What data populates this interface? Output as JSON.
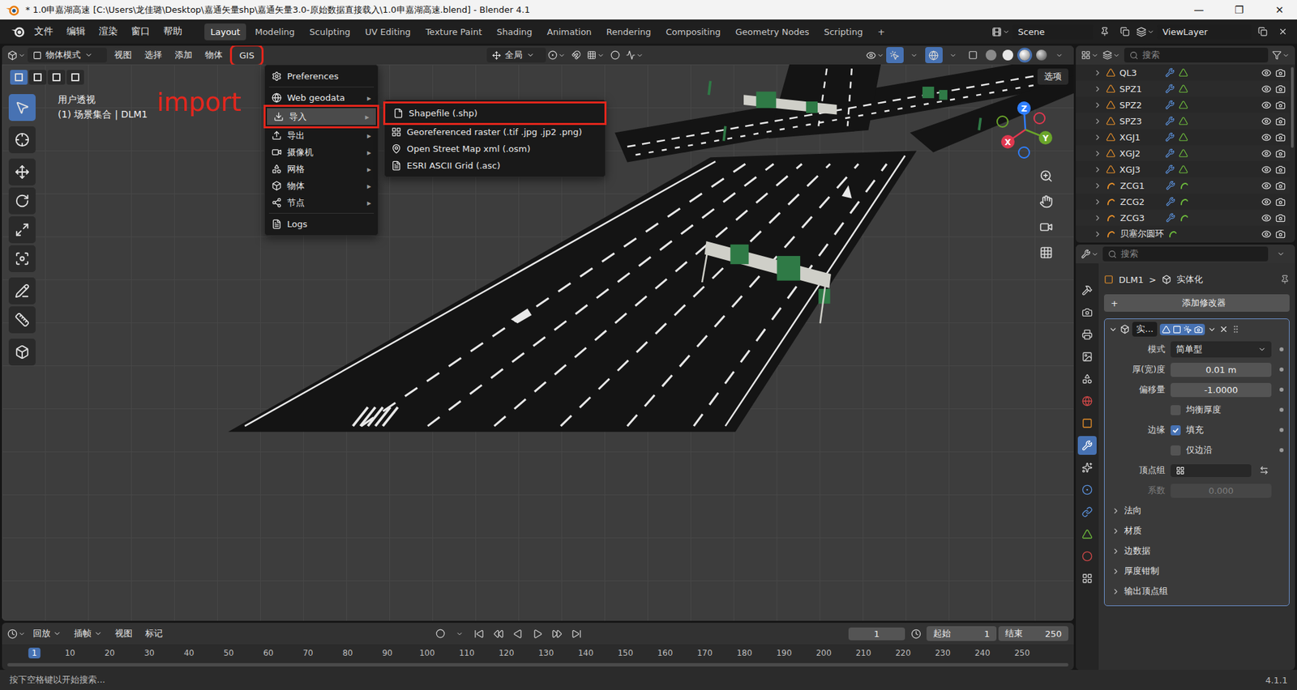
{
  "window": {
    "title": "* 1.0申嘉湖高速 [C:\\Users\\龙佳璐\\Desktop\\嘉通矢量shp\\嘉通矢量3.0-原始数据直接载入\\1.0申嘉湖高速.blend] - Blender 4.1",
    "controls": [
      "—",
      "❐",
      "✕"
    ]
  },
  "menubar": [
    "文件",
    "编辑",
    "渲染",
    "窗口",
    "帮助"
  ],
  "workspaces": [
    {
      "label": "Layout",
      "selected": true
    },
    {
      "label": "Modeling",
      "selected": false
    },
    {
      "label": "Sculpting",
      "selected": false
    },
    {
      "label": "UV Editing",
      "selected": false
    },
    {
      "label": "Texture Paint",
      "selected": false
    },
    {
      "label": "Shading",
      "selected": false
    },
    {
      "label": "Animation",
      "selected": false
    },
    {
      "label": "Rendering",
      "selected": false
    },
    {
      "label": "Compositing",
      "selected": false
    },
    {
      "label": "Geometry Nodes",
      "selected": false
    },
    {
      "label": "Scripting",
      "selected": false
    }
  ],
  "add_workspace": "+",
  "scene": "Scene",
  "view_layer": "ViewLayer",
  "viewport": {
    "mode": "物体模式",
    "menus": [
      {
        "label": "视图",
        "annotated": false
      },
      {
        "label": "选择",
        "annotated": false
      },
      {
        "label": "添加",
        "annotated": false
      },
      {
        "label": "物体",
        "annotated": false
      },
      {
        "label": "GIS",
        "annotated": true
      }
    ],
    "orientation": "全局",
    "options": "选项",
    "info": [
      "用户透视",
      "(1) 场景集合 | DLM1"
    ],
    "axes": {
      "x": "X",
      "y": "Y",
      "z": "Z"
    },
    "select_modes": [
      {
        "selected": true
      },
      {
        "selected": false
      },
      {
        "selected": false
      },
      {
        "selected": false
      }
    ]
  },
  "toolbar": {
    "tools": [
      {
        "selected": true
      },
      {
        "selected": false
      },
      {
        "selected": false
      },
      {
        "selected": false
      },
      {
        "selected": false
      },
      {
        "selected": false
      },
      {
        "selected": false
      },
      {
        "selected": false
      },
      {
        "selected": false
      }
    ]
  },
  "gis_menu": {
    "arrow": "▸",
    "items": [
      {
        "label": "Preferences",
        "submenu": false,
        "selected": false,
        "annotated": false,
        "group": 1
      },
      {
        "label": "Web geodata",
        "submenu": true,
        "selected": false,
        "annotated": false,
        "group": 2
      },
      {
        "label": "导入",
        "submenu": true,
        "selected": true,
        "annotated": true,
        "group": 2
      },
      {
        "label": "导出",
        "submenu": true,
        "selected": false,
        "annotated": false,
        "group": 2
      },
      {
        "label": "摄像机",
        "submenu": true,
        "selected": false,
        "annotated": false,
        "group": 2
      },
      {
        "label": "网格",
        "submenu": true,
        "selected": false,
        "annotated": false,
        "group": 2
      },
      {
        "label": "物体",
        "submenu": true,
        "selected": false,
        "annotated": false,
        "group": 2
      },
      {
        "label": "节点",
        "submenu": true,
        "selected": false,
        "annotated": false,
        "group": 2
      },
      {
        "label": "Logs",
        "submenu": false,
        "selected": false,
        "annotated": false,
        "group": 3
      }
    ]
  },
  "import_menu": [
    {
      "label": "Shapefile (.shp)",
      "annotated": true
    },
    {
      "label": "Georeferenced raster (.tif .jpg .jp2 .png)",
      "annotated": false
    },
    {
      "label": "Open Street Map xml (.osm)",
      "annotated": false
    },
    {
      "label": "ESRI ASCII Grid (.asc)",
      "annotated": false
    }
  ],
  "annotation": {
    "label": "import"
  },
  "outliner": {
    "search": "搜索",
    "rows": [
      {
        "name": "QL3",
        "kind": "mesh",
        "modifier": true
      },
      {
        "name": "SPZ1",
        "kind": "mesh",
        "modifier": true
      },
      {
        "name": "SPZ2",
        "kind": "mesh",
        "modifier": true
      },
      {
        "name": "SPZ3",
        "kind": "mesh",
        "modifier": true
      },
      {
        "name": "XGJ1",
        "kind": "mesh",
        "modifier": true
      },
      {
        "name": "XGJ2",
        "kind": "mesh",
        "modifier": true
      },
      {
        "name": "XGJ3",
        "kind": "mesh",
        "modifier": true
      },
      {
        "name": "ZCG1",
        "kind": "curve",
        "modifier": true
      },
      {
        "name": "ZCG2",
        "kind": "curve",
        "modifier": true
      },
      {
        "name": "ZCG3",
        "kind": "curve",
        "modifier": true
      },
      {
        "name": "贝塞尔圆环",
        "kind": "curve",
        "modifier": false
      }
    ]
  },
  "properties": {
    "search": "搜索",
    "tabs": [
      {
        "selected": false
      },
      {
        "selected": false
      },
      {
        "selected": false
      },
      {
        "selected": false
      },
      {
        "selected": false
      },
      {
        "selected": false
      },
      {
        "selected": false
      },
      {
        "selected": true
      },
      {
        "selected": false
      },
      {
        "selected": false
      },
      {
        "selected": false
      },
      {
        "selected": false
      },
      {
        "selected": false
      },
      {
        "selected": false
      }
    ],
    "object": "DLM1",
    "separator": ">",
    "modifier": "实体化",
    "add_icon": "+",
    "add_label": "添加修改器",
    "panel_name": "实...",
    "fields": [
      {
        "kind": "dropdown",
        "label": "模式",
        "value": "简单型",
        "disabled": false
      },
      {
        "kind": "number",
        "label": "厚(宽)度",
        "value": "0.01 m",
        "disabled": false
      },
      {
        "kind": "number",
        "label": "偏移量",
        "value": "-1.0000",
        "disabled": false
      },
      {
        "kind": "checkbox",
        "label": "",
        "text": "均衡厚度",
        "checked": false
      },
      {
        "kind": "checkbox",
        "label": "边缘",
        "text": "填充",
        "checked": true
      },
      {
        "kind": "checkbox",
        "label": "",
        "text": "仅边沿",
        "checked": false
      },
      {
        "kind": "vertex",
        "label": "顶点组",
        "value": "",
        "disabled": false
      },
      {
        "kind": "number",
        "label": "系数",
        "value": "0.000",
        "disabled": true
      }
    ],
    "sections": [
      "法向",
      "材质",
      "边数据",
      "厚度钳制",
      "输出顶点组"
    ]
  },
  "timeline": {
    "menus": [
      {
        "label": "回放",
        "dropdown": true
      },
      {
        "label": "插帧",
        "dropdown": true
      },
      {
        "label": "视图",
        "dropdown": false
      },
      {
        "label": "标记",
        "dropdown": false
      }
    ],
    "frame": "1",
    "start_label": "起始",
    "start": "1",
    "end_label": "结束",
    "end": "250",
    "current": "1",
    "ticks": [
      "1",
      "10",
      "20",
      "30",
      "40",
      "50",
      "60",
      "70",
      "80",
      "90",
      "100",
      "110",
      "120",
      "130",
      "140",
      "150",
      "160",
      "170",
      "180",
      "190",
      "200",
      "210",
      "220",
      "230",
      "240",
      "250"
    ]
  },
  "status_bar": {
    "hint": "按下空格键以开始搜索...",
    "version": "4.1.1"
  }
}
